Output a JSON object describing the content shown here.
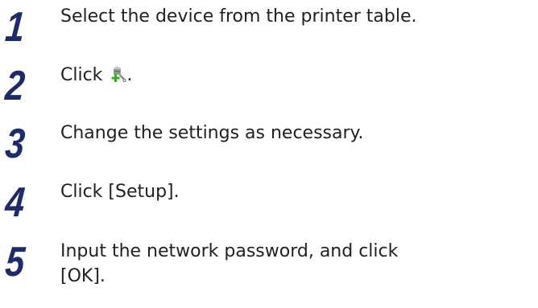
{
  "steps": [
    {
      "number": "1",
      "text": "Select the device from the printer table."
    },
    {
      "number": "2",
      "text_before_icon": "Click",
      "icon": "device-settings-tool-icon",
      "text_after_icon": "."
    },
    {
      "number": "3",
      "text": "Change the settings as necessary."
    },
    {
      "number": "4",
      "text": "Click [Setup]."
    },
    {
      "number": "5",
      "text_line1": "Input the network password, and click",
      "text_line2": "[OK]."
    }
  ],
  "colors": {
    "step_number": "#1c2b6b",
    "body_text": "#231f20",
    "icon_green": "#39a935",
    "icon_gray": "#8a8a8a"
  }
}
